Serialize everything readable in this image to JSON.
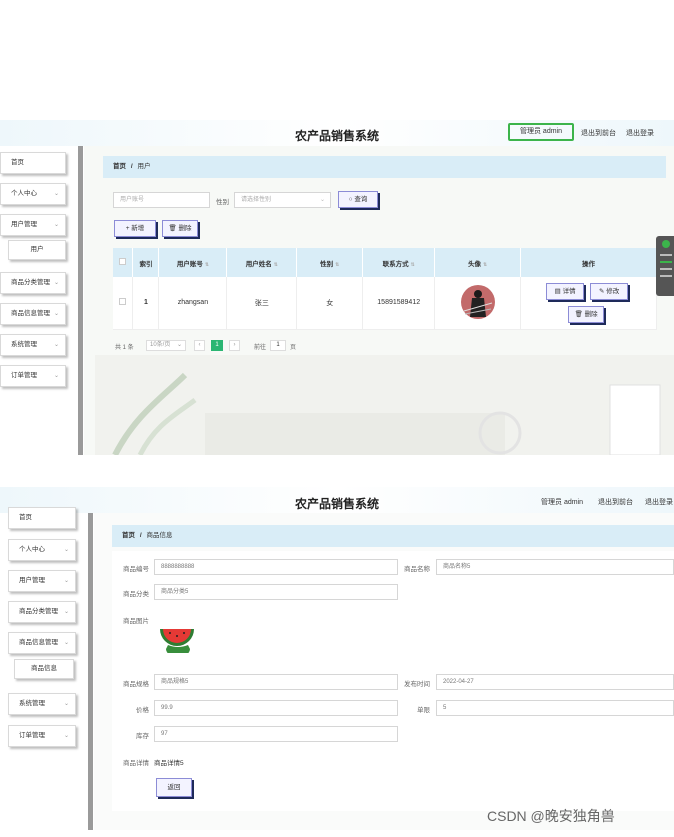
{
  "shot1": {
    "header": {
      "title": "农产品销售系统",
      "admin": "管理员 admin",
      "back_front": "退出到前台",
      "logout": "退出登录"
    },
    "sidebar": {
      "items": [
        {
          "label": "首页"
        },
        {
          "label": "个人中心"
        },
        {
          "label": "用户管理"
        },
        {
          "label": "用户",
          "sub": true
        },
        {
          "label": "商品分类管理"
        },
        {
          "label": "商品信息管理"
        },
        {
          "label": "系统管理"
        },
        {
          "label": "订单管理"
        }
      ]
    },
    "breadcrumb": {
      "home": "首页",
      "sep": "/",
      "current": "用户"
    },
    "search": {
      "account_placeholder": "用户账号",
      "gender_label": "性别",
      "gender_placeholder": "请选择性别",
      "query_button": "查询"
    },
    "actions": {
      "add": "新增",
      "delete": "删除"
    },
    "table": {
      "headers": [
        "索引",
        "用户账号",
        "用户姓名",
        "性别",
        "联系方式",
        "头像",
        "操作"
      ],
      "rows": [
        {
          "index": "1",
          "account": "zhangsan",
          "name": "张三",
          "gender": "女",
          "phone": "15891589412",
          "detail": "详情",
          "edit": "修改",
          "remove": "删除"
        }
      ]
    },
    "pager": {
      "total": "共 1 条",
      "per_page": "10条/页",
      "current": "1",
      "goto_label": "前往",
      "goto_value": "1",
      "page_suffix": "页"
    }
  },
  "shot2": {
    "header": {
      "title": "农产品销售系统",
      "admin": "管理员 admin",
      "back_front": "退出到前台",
      "logout": "退出登录"
    },
    "sidebar": {
      "items": [
        {
          "label": "首页"
        },
        {
          "label": "个人中心"
        },
        {
          "label": "用户管理"
        },
        {
          "label": "商品分类管理"
        },
        {
          "label": "商品信息管理"
        },
        {
          "label": "商品信息",
          "sub": true
        },
        {
          "label": "系统管理"
        },
        {
          "label": "订单管理"
        }
      ]
    },
    "breadcrumb": {
      "home": "首页",
      "sep": "/",
      "current": "商品信息"
    },
    "form": {
      "code_label": "商品编号",
      "code_value": "8888888888",
      "name_label": "商品名称",
      "name_value": "商品名称5",
      "category_label": "商品分类",
      "category_value": "商品分类5",
      "image_label": "商品图片",
      "spec_label": "商品规格",
      "spec_value": "商品规格5",
      "date_label": "发布时间",
      "date_value": "2022-04-27",
      "price_label": "价格",
      "price_value": "99.9",
      "limit_label": "单限",
      "limit_value": "5",
      "stock_label": "库存",
      "stock_value": "97",
      "detail_label": "商品详情",
      "detail_value": "商品详情5",
      "back_button": "返回"
    }
  },
  "watermark": "CSDN @晚安独角兽",
  "colors": {
    "accent_green": "#2bb673",
    "header_blue": "#d9edf7",
    "admin_border": "#3cb44b"
  }
}
